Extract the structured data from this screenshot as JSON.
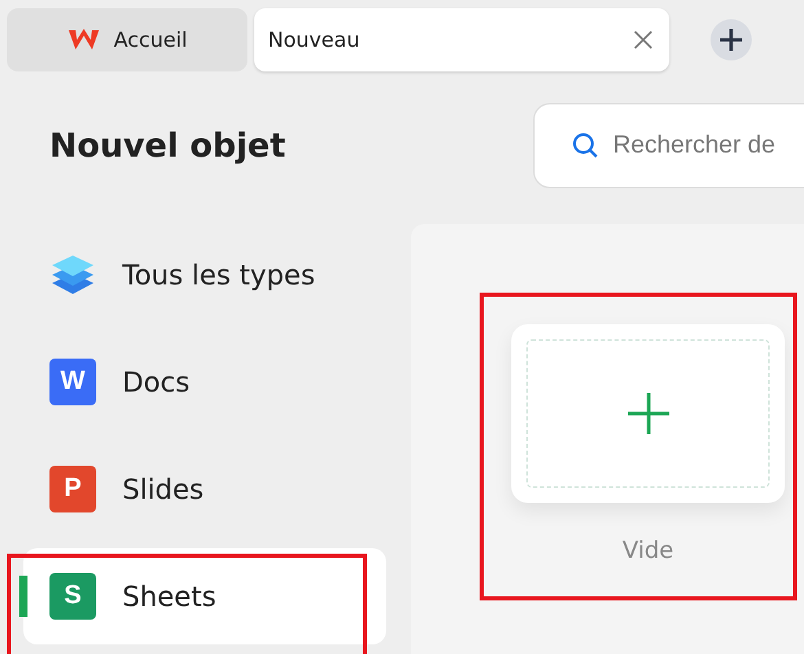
{
  "tabs": [
    {
      "kind": "home",
      "label": "Accueil",
      "selected": false
    },
    {
      "kind": "doc",
      "label": "Nouveau",
      "selected": true
    }
  ],
  "title": "Nouvel objet",
  "search": {
    "placeholder": "Rechercher de"
  },
  "sidebar": {
    "items": [
      {
        "kind": "layers",
        "label": "Tous les types",
        "selected": false
      },
      {
        "kind": "letter",
        "letter": "W",
        "color": "#3a6cf6",
        "label": "Docs",
        "selected": false
      },
      {
        "kind": "letter",
        "letter": "P",
        "color": "#e2472c",
        "label": "Slides",
        "selected": false
      },
      {
        "kind": "letter",
        "letter": "S",
        "color": "#1b9a62",
        "label": "Sheets",
        "selected": true
      }
    ]
  },
  "templates": [
    {
      "label": "Vide"
    }
  ]
}
